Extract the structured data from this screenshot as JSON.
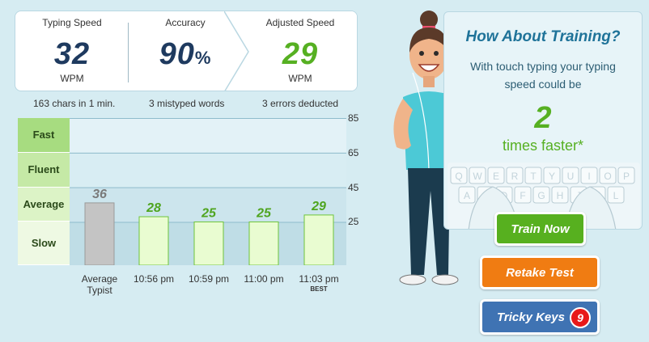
{
  "stats": {
    "typing_speed": {
      "label": "Typing Speed",
      "value": "32",
      "unit": "WPM"
    },
    "accuracy": {
      "label": "Accuracy",
      "value": "90",
      "unit": "%"
    },
    "adjusted_speed": {
      "label": "Adjusted Speed",
      "value": "29",
      "unit": "WPM"
    },
    "subtexts": [
      "163 chars in 1 min.",
      "3 mistyped words",
      "3 errors deducted"
    ]
  },
  "chart_data": {
    "type": "bar",
    "categories": [
      "Average Typist",
      "10:56 pm",
      "10:59 pm",
      "11:00 pm",
      "11:03 pm"
    ],
    "values": [
      36,
      28,
      25,
      25,
      29
    ],
    "value_labels": [
      "36",
      "28",
      "25",
      "25",
      "29"
    ],
    "best_index": 4,
    "best_label": "BEST",
    "y_ticks": [
      85,
      65,
      45,
      25
    ],
    "ylim": [
      0,
      85
    ],
    "bands": [
      {
        "label": "Fast",
        "from": 65,
        "to": 85,
        "color": "#a7dc80"
      },
      {
        "label": "Fluent",
        "from": 45,
        "to": 65,
        "color": "#c5e9a6"
      },
      {
        "label": "Average",
        "from": 25,
        "to": 45,
        "color": "#dcf3c6"
      },
      {
        "label": "Slow",
        "from": 0,
        "to": 25,
        "color": "#eef9e3"
      }
    ],
    "colors": {
      "average": "#c4c4c4",
      "session": "#e9fcd1",
      "session_border": "#6ec43a",
      "label_green": "#4fa520"
    }
  },
  "training": {
    "title": "How About Training?",
    "desc_line1": "With touch typing your typing",
    "desc_line2": "speed could be",
    "number": "2",
    "sub": "times faster*",
    "keyboard_keys": [
      "Q",
      "W",
      "E",
      "R",
      "T",
      "Y",
      "U",
      "I",
      "O",
      "P",
      "A",
      "S",
      "D",
      "F",
      "G",
      "H",
      "J",
      "K",
      "L"
    ]
  },
  "buttons": {
    "train": "Train Now",
    "retake": "Retake Test",
    "tricky": "Tricky Keys",
    "tricky_count": "9"
  }
}
